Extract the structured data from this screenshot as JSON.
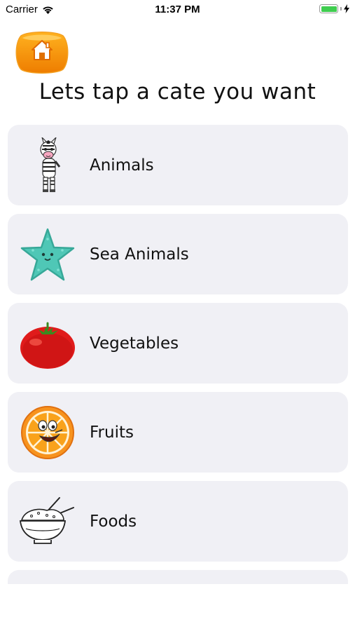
{
  "status_bar": {
    "carrier": "Carrier",
    "time": "11:37 PM",
    "battery_percent": 100
  },
  "home_button": {
    "icon": "home-icon"
  },
  "title": "Lets tap a cate you want",
  "categories": [
    {
      "label": "Animals",
      "icon": "zebra-icon"
    },
    {
      "label": "Sea Animals",
      "icon": "starfish-icon"
    },
    {
      "label": "Vegetables",
      "icon": "tomato-icon"
    },
    {
      "label": "Fruits",
      "icon": "orange-icon"
    },
    {
      "label": "Foods",
      "icon": "rice-bowl-icon"
    }
  ],
  "colors": {
    "card_bg": "#f0f0f5",
    "home_orange": "#f39200",
    "battery_green": "#3fcd4f"
  }
}
